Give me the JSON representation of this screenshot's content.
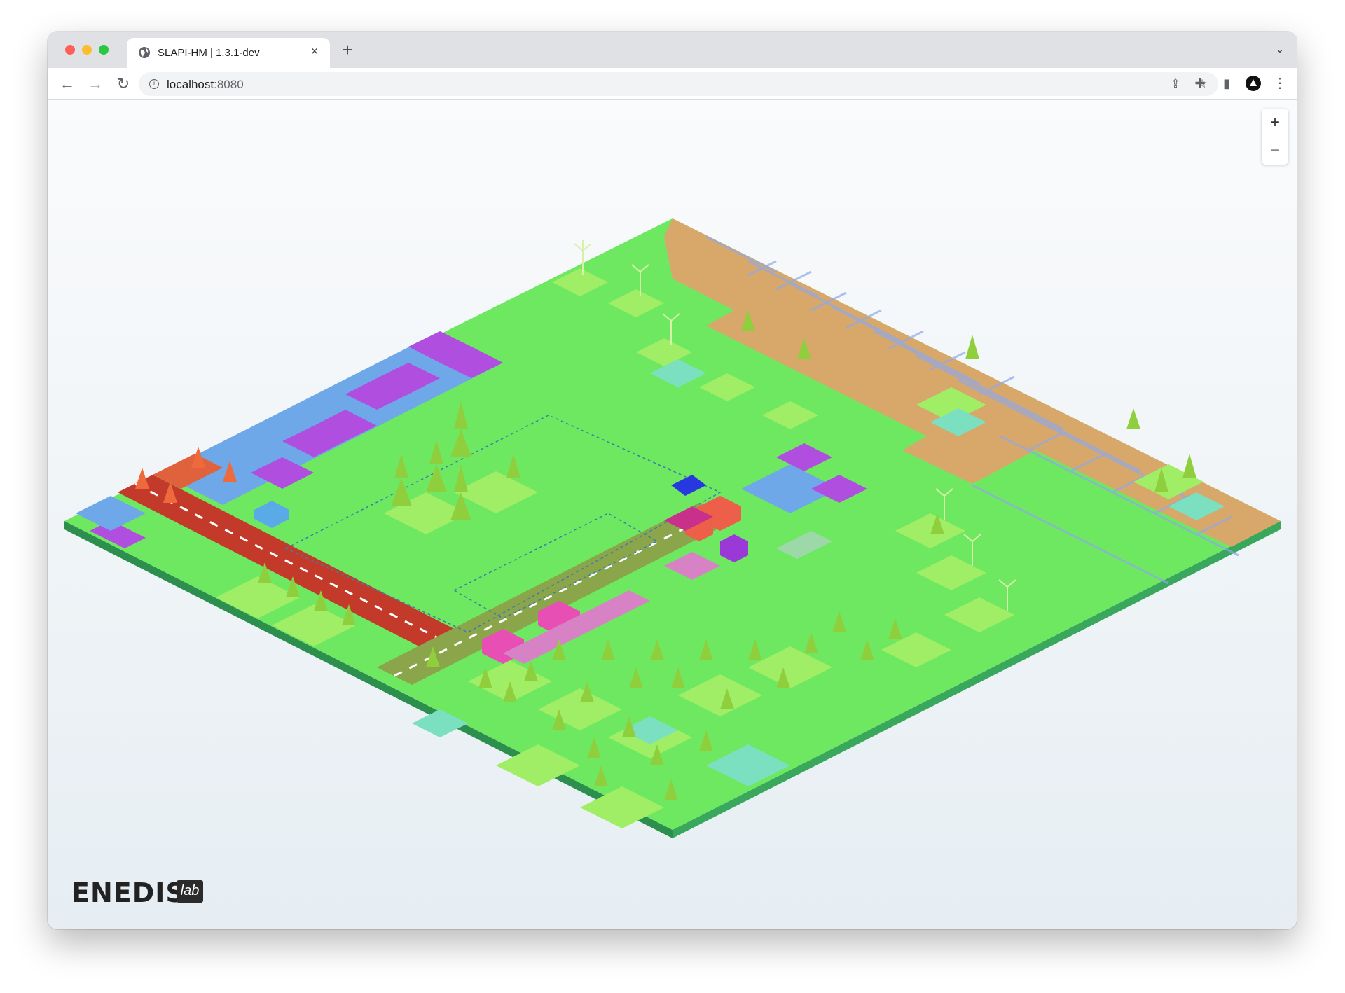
{
  "browser": {
    "tab_title": "SLAPI-HM | 1.3.1-dev",
    "tab_close": "×",
    "new_tab": "+",
    "url_host": "localhost",
    "url_port": ":8080"
  },
  "map": {
    "zoom_in": "+",
    "zoom_out": "−",
    "colors": {
      "grass": "#6ee860",
      "grass_light": "#a0ee66",
      "farmland": "#d8a86a",
      "plot_blue": "#6fa8e8",
      "plot_purple": "#b04ee0",
      "road": "#8ba54a",
      "road_red": "#c43a2a",
      "building_pink": "#e84fb4",
      "building_purple": "#9a38d8",
      "building_red": "#ee5f4a",
      "tree": "#8fcf3e",
      "tree_orange": "#ee6a3c",
      "water": "#7be0c0"
    }
  },
  "logo": {
    "brand": "ENEDIS",
    "badge": "lab"
  }
}
